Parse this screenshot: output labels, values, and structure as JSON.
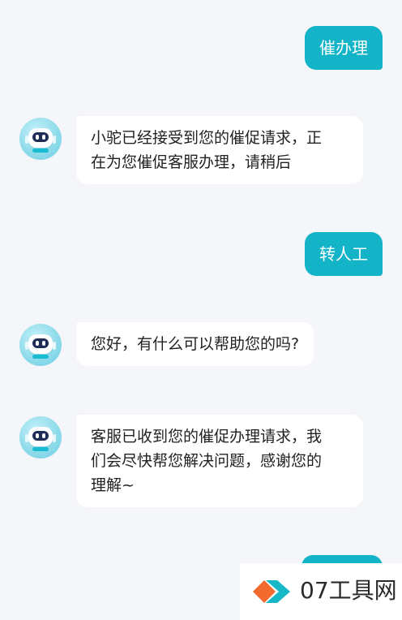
{
  "messages": [
    {
      "sender": "user",
      "text": "催办理"
    },
    {
      "sender": "bot",
      "lines": [
        "小驼已经接受到您的催促请求，正",
        "在为您催促客服办理，请稍后"
      ]
    },
    {
      "sender": "user",
      "text": "转人工"
    },
    {
      "sender": "bot",
      "lines": [
        "您好，有什么可以帮助您的吗?"
      ]
    },
    {
      "sender": "bot",
      "lines": [
        "客服已收到您的催促办理请求，我",
        "们会尽快帮您解决问题，感谢您的",
        "理解~"
      ]
    }
  ],
  "watermark": {
    "text": "07工具网"
  },
  "colors": {
    "user_bubble": "#14b4c8",
    "bot_bubble": "#ffffff",
    "background": "#f4f6f9",
    "watermark_orange": "#f26a2e",
    "watermark_cyan": "#16b8c8"
  },
  "icons": {
    "bot_avatar": "robot-avatar-icon",
    "watermark_logo": "diamond-logo-icon"
  }
}
